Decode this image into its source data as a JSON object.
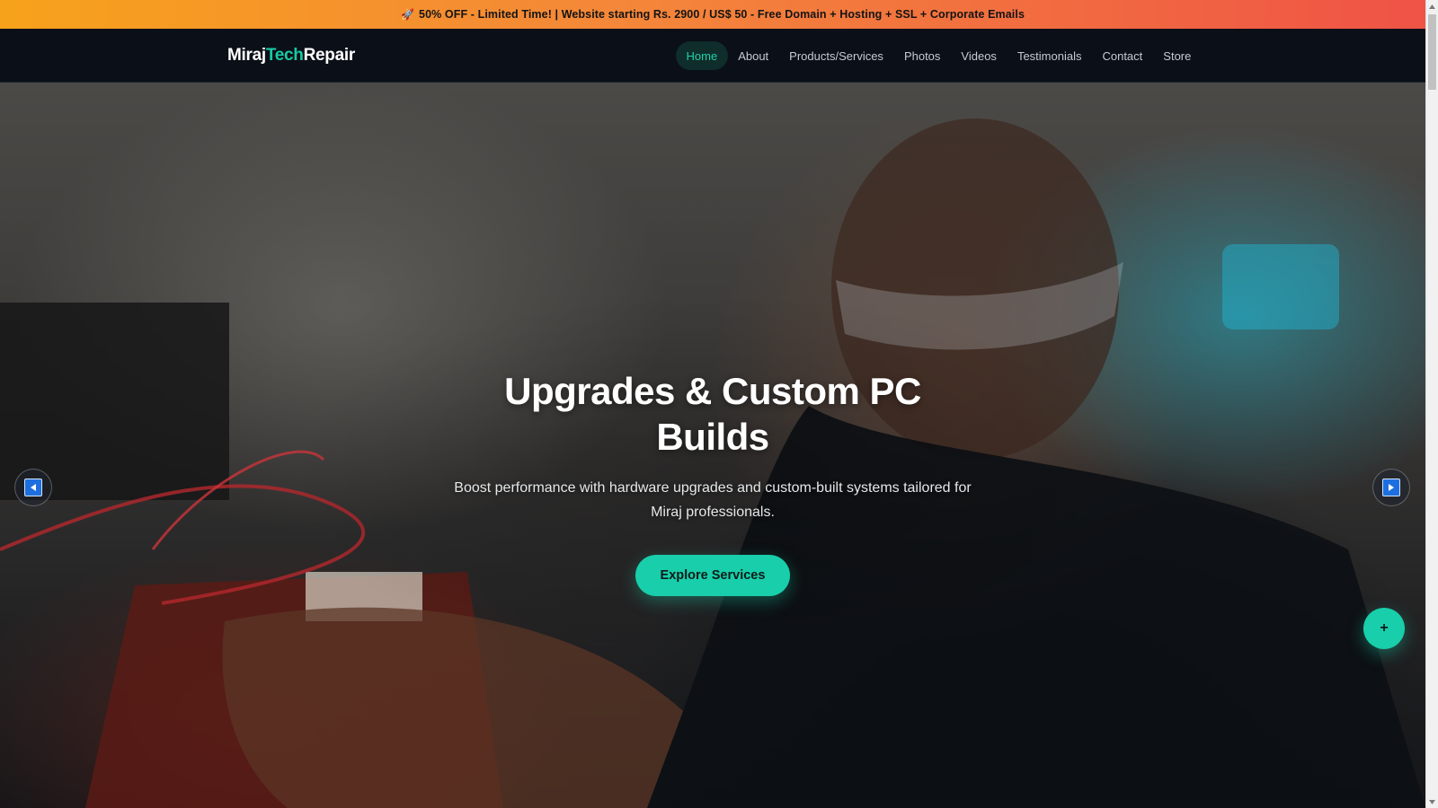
{
  "promo": {
    "icon": "rocket-icon",
    "text": "50% OFF - Limited Time! | Website starting Rs. 2900 / US$ 50 - Free Domain + Hosting + SSL + Corporate Emails"
  },
  "brand": {
    "part1": "Miraj",
    "part2": "Tech",
    "part3": "Repair"
  },
  "nav": {
    "items": [
      {
        "label": "Home",
        "active": true
      },
      {
        "label": "About"
      },
      {
        "label": "Products/Services"
      },
      {
        "label": "Photos"
      },
      {
        "label": "Videos"
      },
      {
        "label": "Testimonials"
      },
      {
        "label": "Contact"
      },
      {
        "label": "Store"
      }
    ]
  },
  "hero": {
    "title": "Upgrades & Custom PC Builds",
    "subtitle": "Boost performance with hardware upgrades and custom-built systems tailored for Miraj professionals.",
    "cta_label": "Explore Services",
    "prev_icon": "arrow-left-icon",
    "next_icon": "arrow-right-icon"
  },
  "fab": {
    "label": "+"
  },
  "colors": {
    "accent": "#19ceaa",
    "promo_start": "#f7a21b",
    "promo_end": "#ef5346",
    "nav_bg": "#0b0f17"
  }
}
